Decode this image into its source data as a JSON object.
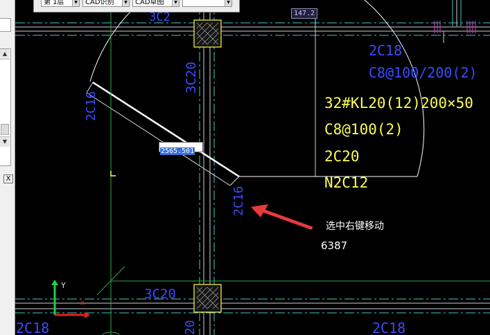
{
  "toolbar": {
    "floor_select": "第 1层",
    "cad_identify_select": "CAD识别",
    "cad_drawing_select": "CAD草图",
    "blank_select": ""
  },
  "length_readout": "147.2",
  "dimension_input": "2565.501",
  "left_panel": {
    "close_label": "X"
  },
  "labels": {
    "bar_2c18_top": "2C18",
    "stirrup_top": "C8@100/200(2)",
    "beam_name": "32#KL20(12)200×50",
    "stirrup": "C8@100(2)",
    "bar_2c20": "2C20",
    "n2c12": "N2C12",
    "col_3c20_vertical": "3C20",
    "col_3c20_bottom": "3C20",
    "bar_2c18_bottom": "2C18",
    "bar_2c18_left": "2C18",
    "bar_20_bottom": "20",
    "bar_2c16_upper": "2C16",
    "bar_2c16_lower": "2C16"
  },
  "note": {
    "text": "选中右键移动",
    "number": "6387"
  },
  "ucs": {
    "y_label": "Y",
    "x_label": "X"
  },
  "colors": {
    "background": "#000000",
    "beam_text": "#ffff55",
    "rebar_text": "#3a4cff",
    "axis_lines": "#40c8c8",
    "green": "#2ea84a",
    "arrow_red": "#e83a3a"
  }
}
